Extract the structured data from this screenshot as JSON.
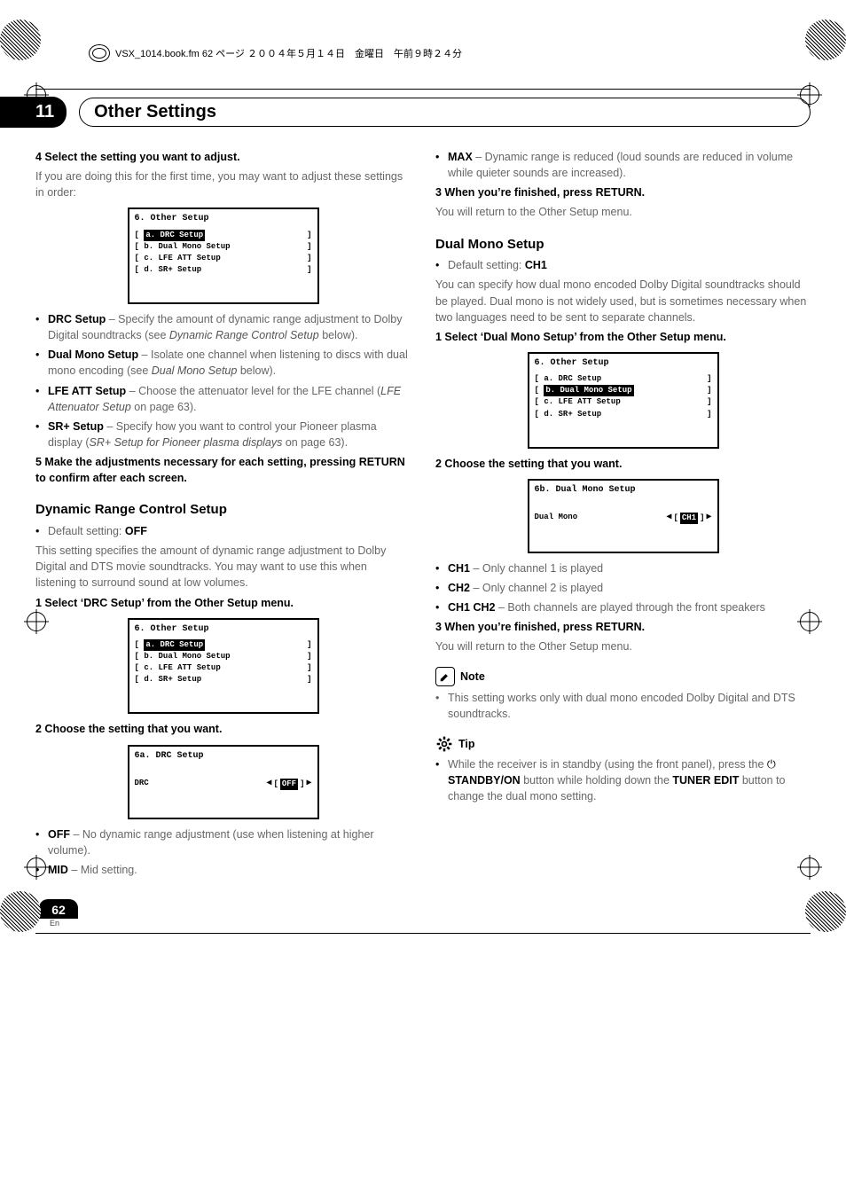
{
  "header": {
    "filename_line": "VSX_1014.book.fm  62 ページ  ２００４年５月１４日　金曜日　午前９時２４分"
  },
  "chapter": {
    "num": "11",
    "title": "Other Settings"
  },
  "left": {
    "s4h": "4   Select the setting you want to adjust.",
    "s4p": "If you are doing this for the first time, you may want to adjust these settings in order:",
    "osd1": {
      "title": "6. Other Setup",
      "a": "a. DRC Setup",
      "b": "b. Dual Mono Setup",
      "c": "c. LFE ATT Setup",
      "d": "d. SR+ Setup"
    },
    "li_drc_b": "DRC Setup",
    "li_drc": " – Specify the amount of dynamic range adjustment to Dolby Digital soundtracks (see ",
    "li_drc_i": "Dynamic Range Control Setup",
    "li_drc_after": " below).",
    "li_dm_b": "Dual Mono Setup",
    "li_dm": " – Isolate one channel when listening to discs with dual mono encoding (see ",
    "li_dm_i": "Dual Mono Setup",
    "li_dm_after": " below).",
    "li_lfe_b": "LFE ATT Setup",
    "li_lfe": " – Choose the attenuator level for the LFE channel (",
    "li_lfe_i": "LFE Attenuator Setup",
    "li_lfe_after": " on page 63).",
    "li_sr_b": "SR+ Setup",
    "li_sr": " – Specify how you want to control your Pioneer plasma display (",
    "li_sr_i": "SR+ Setup for Pioneer plasma displays",
    "li_sr_after": " on page 63).",
    "s5h": "5   Make the adjustments necessary for each setting, pressing RETURN to confirm after each screen.",
    "drc_h": "Dynamic Range Control Setup",
    "drc_def": "Default setting: ",
    "drc_def_b": "OFF",
    "drc_p": "This setting specifies the amount of dynamic range adjustment to Dolby Digital and DTS movie soundtracks. You may want to use this when listening to surround sound at low volumes.",
    "drc_s1": "1   Select ‘DRC Setup’ from the Other Setup menu.",
    "osd2": {
      "title": "6. Other Setup",
      "a": "a. DRC Setup",
      "b": "b. Dual Mono Setup",
      "c": "c. LFE ATT Setup",
      "d": "d. SR+ Setup"
    },
    "drc_s2": "2   Choose the setting that you want.",
    "osd3": {
      "title": "6a. DRC Setup",
      "lab": "DRC",
      "val": "OFF"
    },
    "li_off_b": "OFF",
    "li_off": " – No dynamic range adjustment (use when listening at higher volume).",
    "li_mid_b": "MID",
    "li_mid": " – Mid setting."
  },
  "right": {
    "li_max_b": "MAX",
    "li_max": " – Dynamic range is reduced (loud sounds are reduced in volume while quieter sounds are increased).",
    "s3h": "3   When you’re finished, press RETURN.",
    "s3p": "You will return to the Other Setup menu.",
    "dm_h": "Dual Mono Setup",
    "dm_def": "Default setting: ",
    "dm_def_b": "CH1",
    "dm_p": "You can specify how dual mono encoded Dolby Digital soundtracks should be played. Dual mono is not widely used, but is sometimes necessary when two languages need to be sent to separate channels.",
    "dm_s1": "1   Select ‘Dual Mono Setup’ from the Other Setup menu.",
    "osd4": {
      "title": "6. Other Setup",
      "a": "a. DRC Setup",
      "b": "b. Dual Mono Setup",
      "c": "c. LFE ATT Setup",
      "d": "d. SR+ Setup"
    },
    "dm_s2": "2   Choose the setting that you want.",
    "osd5": {
      "title": "6b. Dual Mono Setup",
      "lab": "Dual Mono",
      "val": "CH1"
    },
    "li_ch1_b": "CH1",
    "li_ch1": " – Only channel 1 is played",
    "li_ch2_b": "CH2",
    "li_ch2": " – Only channel 2 is played",
    "li_ch12_b": "CH1 CH2",
    "li_ch12": " – Both channels are played through the front speakers",
    "s3bh": "3   When you’re finished, press RETURN.",
    "s3bp": "You will return to the Other Setup menu.",
    "note_h": "Note",
    "note_t": "This setting works only with dual mono encoded Dolby Digital and DTS soundtracks.",
    "tip_h": "Tip",
    "tip_t1": "While the receiver is in standby (using the front panel), press the ",
    "tip_b1": "STANDBY/ON",
    "tip_t2": " button while holding down the ",
    "tip_b2": "TUNER EDIT",
    "tip_t3": " button to change the dual mono setting."
  },
  "footer": {
    "page": "62",
    "lang": "En"
  }
}
